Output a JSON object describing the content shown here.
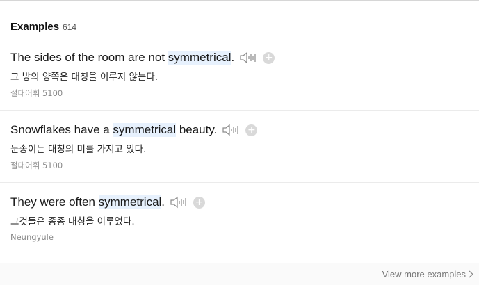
{
  "header": {
    "title": "Examples",
    "count": "614"
  },
  "examples": [
    {
      "before": "The sides of the room are not ",
      "highlight": "symmetrical",
      "after": ".",
      "translation": "그 방의 양쪽은 대칭을 이루지 않는다.",
      "source": "절대어휘 5100"
    },
    {
      "before": "Snowflakes have a ",
      "highlight": "symmetrical",
      "after": " beauty.",
      "translation": "눈송이는 대칭의 미를 가지고 있다.",
      "source": "절대어휘 5100"
    },
    {
      "before": "They were often ",
      "highlight": "symmetrical",
      "after": ".",
      "translation": "그것들은 종종 대칭을 이루었다.",
      "source": "Neungyule"
    }
  ],
  "footer": {
    "more_label": "View more examples"
  },
  "icons": {
    "audio": "speaker-icon",
    "add": "plus-circle-icon",
    "more": "chevron-right-icon"
  },
  "colors": {
    "highlight": "#e7f1fd",
    "add_button": "#d9d9d9"
  }
}
